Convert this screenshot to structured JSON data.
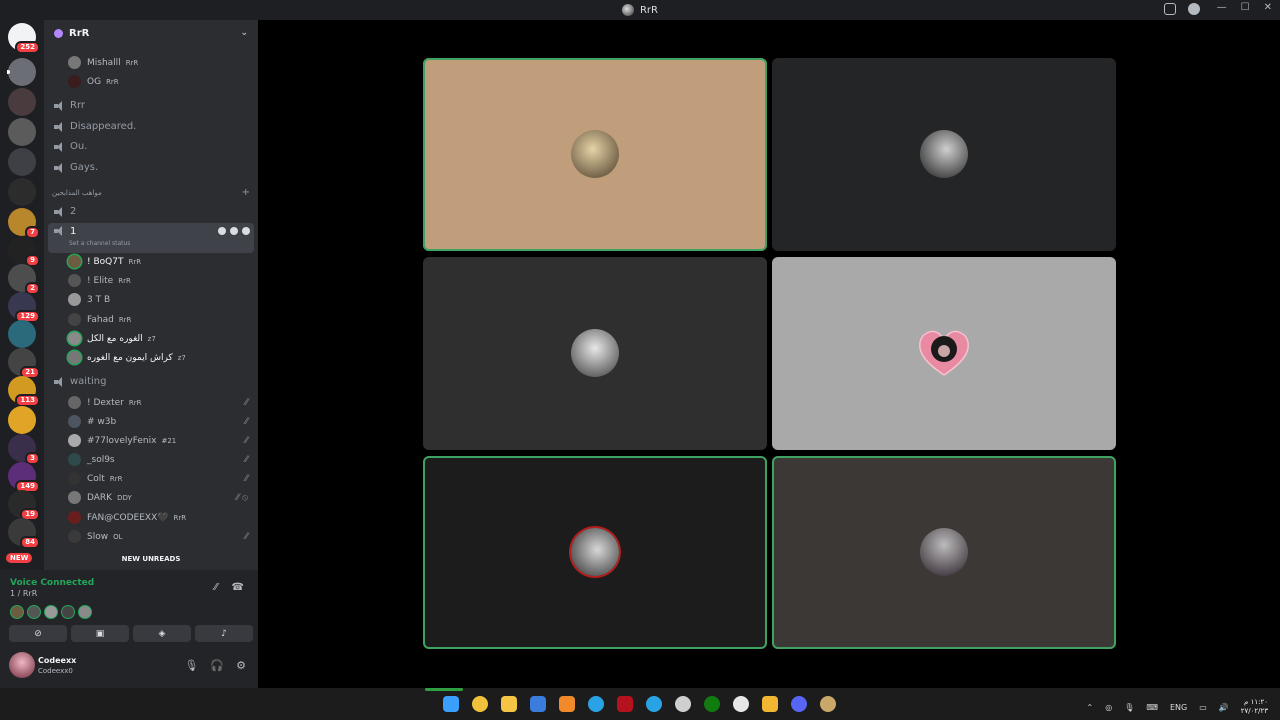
{
  "window": {
    "title": "RrR"
  },
  "rail": {
    "servers": [
      {
        "badge": "252"
      },
      {
        "badge": ""
      },
      {
        "badge": ""
      },
      {
        "badge": ""
      },
      {
        "badge": ""
      },
      {
        "badge": ""
      },
      {
        "badge": "7"
      },
      {
        "badge": "9"
      },
      {
        "badge": "2"
      },
      {
        "badge": "129"
      },
      {
        "badge": ""
      },
      {
        "badge": "21"
      },
      {
        "badge": "113"
      },
      {
        "badge": ""
      },
      {
        "badge": "3"
      },
      {
        "badge": "149"
      },
      {
        "badge": "19"
      },
      {
        "badge": "84"
      }
    ],
    "new_label": "NEW"
  },
  "server": {
    "name": "RrR"
  },
  "channels": {
    "top_members": [
      {
        "name": "Mishalll",
        "tag": "RrR"
      },
      {
        "name": "OG",
        "tag": "RrR"
      }
    ],
    "voice_channels": [
      "Rrr",
      "Disappeared.",
      "Ou.",
      "Gays."
    ],
    "category": "مواهب المذابحين",
    "channel_2": "2",
    "selected_channel": {
      "name": "1",
      "status": "Set a channel status"
    },
    "channel_1_members": [
      {
        "name": "! BoQ7T",
        "tag": "RrR"
      },
      {
        "name": "! Elite",
        "tag": "RrR"
      },
      {
        "name": "3 T B",
        "tag": ""
      },
      {
        "name": "Fahad",
        "tag": "RrR"
      },
      {
        "name": "الغوره مع الكل",
        "tag": "z7"
      },
      {
        "name": "كراش ايمون مع الغوره",
        "tag": "z7"
      }
    ],
    "waiting_channel": "waiting",
    "waiting_members": [
      {
        "name": "! Dexter",
        "tag": "RrR"
      },
      {
        "name": "# w3b",
        "tag": ""
      },
      {
        "name": "#77lovelyFenix",
        "tag": "#21"
      },
      {
        "name": "_sol9s",
        "tag": ""
      },
      {
        "name": "Colt",
        "tag": "RrR"
      },
      {
        "name": "DARK",
        "tag": "DDY"
      },
      {
        "name": "FAN@CODEEXX🖤",
        "tag": "RrR"
      },
      {
        "name": "Slow",
        "tag": "OL"
      }
    ],
    "new_unreads": "NEW UNREADS"
  },
  "voice": {
    "status": "Voice Connected",
    "location": "1 / RrR"
  },
  "user": {
    "name": "Codeexx",
    "subtitle": "Codeexx0"
  },
  "tiles": [
    {
      "bg": "#c09e7b",
      "speaking": true
    },
    {
      "bg": "#232526",
      "speaking": false
    },
    {
      "bg": "#2f2f2f",
      "speaking": false
    },
    {
      "bg": "#a9a9a9",
      "speaking": false
    },
    {
      "bg": "#1c1c1c",
      "speaking": true
    },
    {
      "bg": "#3b3835",
      "speaking": true
    }
  ],
  "taskbar": {
    "lang": "ENG",
    "time": "١١:٢٠ م",
    "date": "٢٧/٠٢/٢٣"
  },
  "colors": {
    "accent_green": "#23a55a",
    "badge_red": "#f23f43"
  }
}
